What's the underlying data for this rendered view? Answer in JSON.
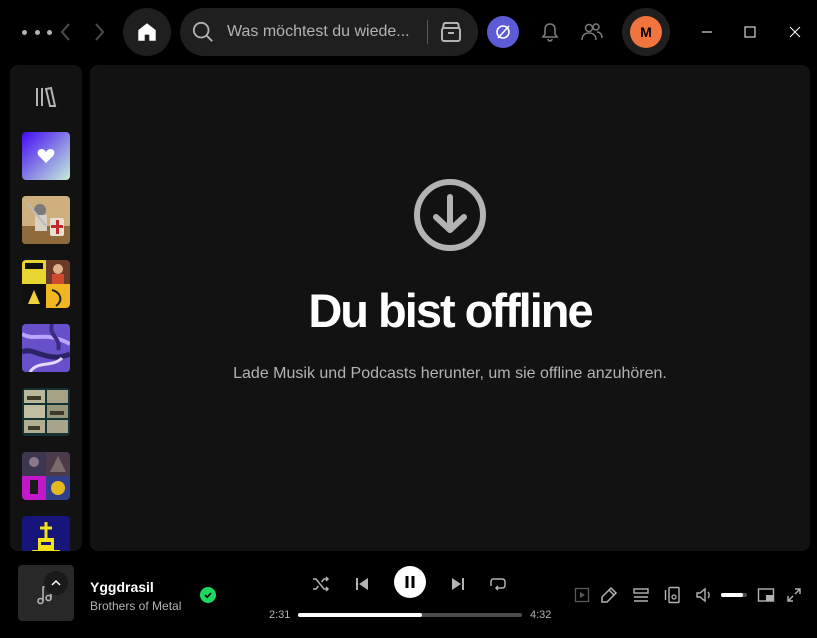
{
  "topbar": {
    "search_placeholder": "Was möchtest du wiede...",
    "avatar_initial": "M"
  },
  "main": {
    "title": "Du bist offline",
    "subtitle": "Lade Musik und Podcasts herunter, um sie offline anzuhören."
  },
  "now_playing": {
    "title": "Yggdrasil",
    "artist": "Brothers of Metal",
    "elapsed": "2:31",
    "duration": "4:32",
    "progress_fraction": 0.555,
    "volume_fraction": 0.85
  },
  "colors": {
    "accent_green": "#1ed760",
    "offline_badge": "#5b5bd6",
    "avatar": "#f0743d",
    "surface": "#121212",
    "background": "#000000"
  },
  "sidebar": {
    "items": [
      {
        "name": "liked-songs"
      },
      {
        "name": "playlist-crusader"
      },
      {
        "name": "playlist-rem"
      },
      {
        "name": "playlist-purple"
      },
      {
        "name": "playlist-collage"
      },
      {
        "name": "playlist-metal-collage"
      },
      {
        "name": "playlist-yellow-ship"
      }
    ]
  }
}
